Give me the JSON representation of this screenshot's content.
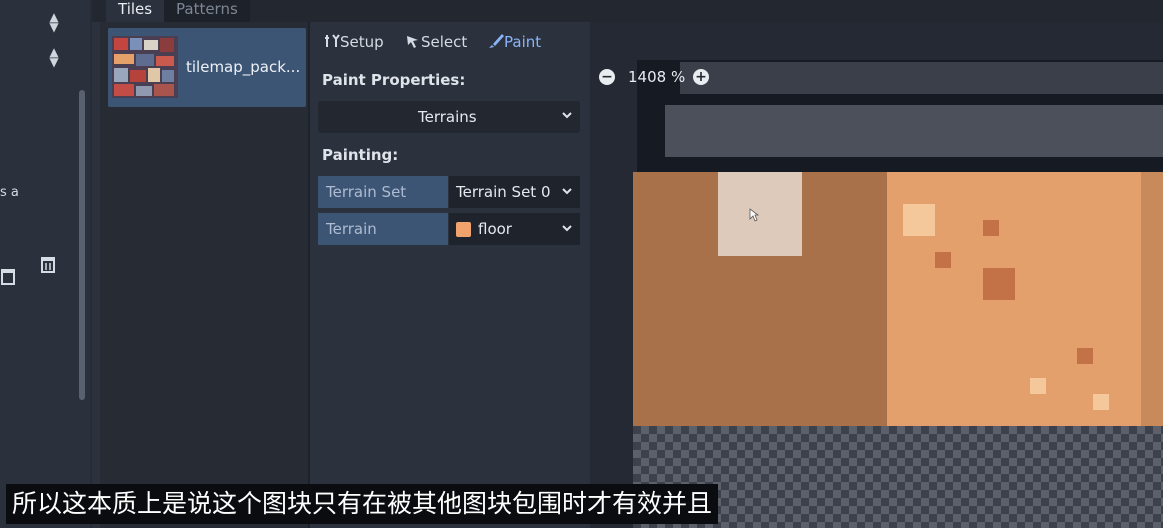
{
  "tabs": {
    "tiles": "Tiles",
    "patterns": "Patterns"
  },
  "left_dock": {
    "partial_text": "s a"
  },
  "tileset": {
    "name": "tilemap_pack..."
  },
  "toolbar": {
    "setup": "Setup",
    "select": "Select",
    "paint": "Paint"
  },
  "paint_properties": {
    "heading": "Paint Properties:",
    "mode_value": "Terrains"
  },
  "painting": {
    "heading": "Painting:",
    "terrain_set_label": "Terrain Set",
    "terrain_set_value": "Terrain Set 0",
    "terrain_label": "Terrain",
    "terrain_value": "floor",
    "terrain_color": "#f0a36c"
  },
  "viewer": {
    "zoom_value": "1408 %"
  },
  "subtitle": "所以这本质上是说这个图块只有在被其他图块包围时才有效并且",
  "colors": {
    "accent": "#3d5575",
    "background": "#2b313d",
    "paint_tool": "#8ab4f8"
  }
}
